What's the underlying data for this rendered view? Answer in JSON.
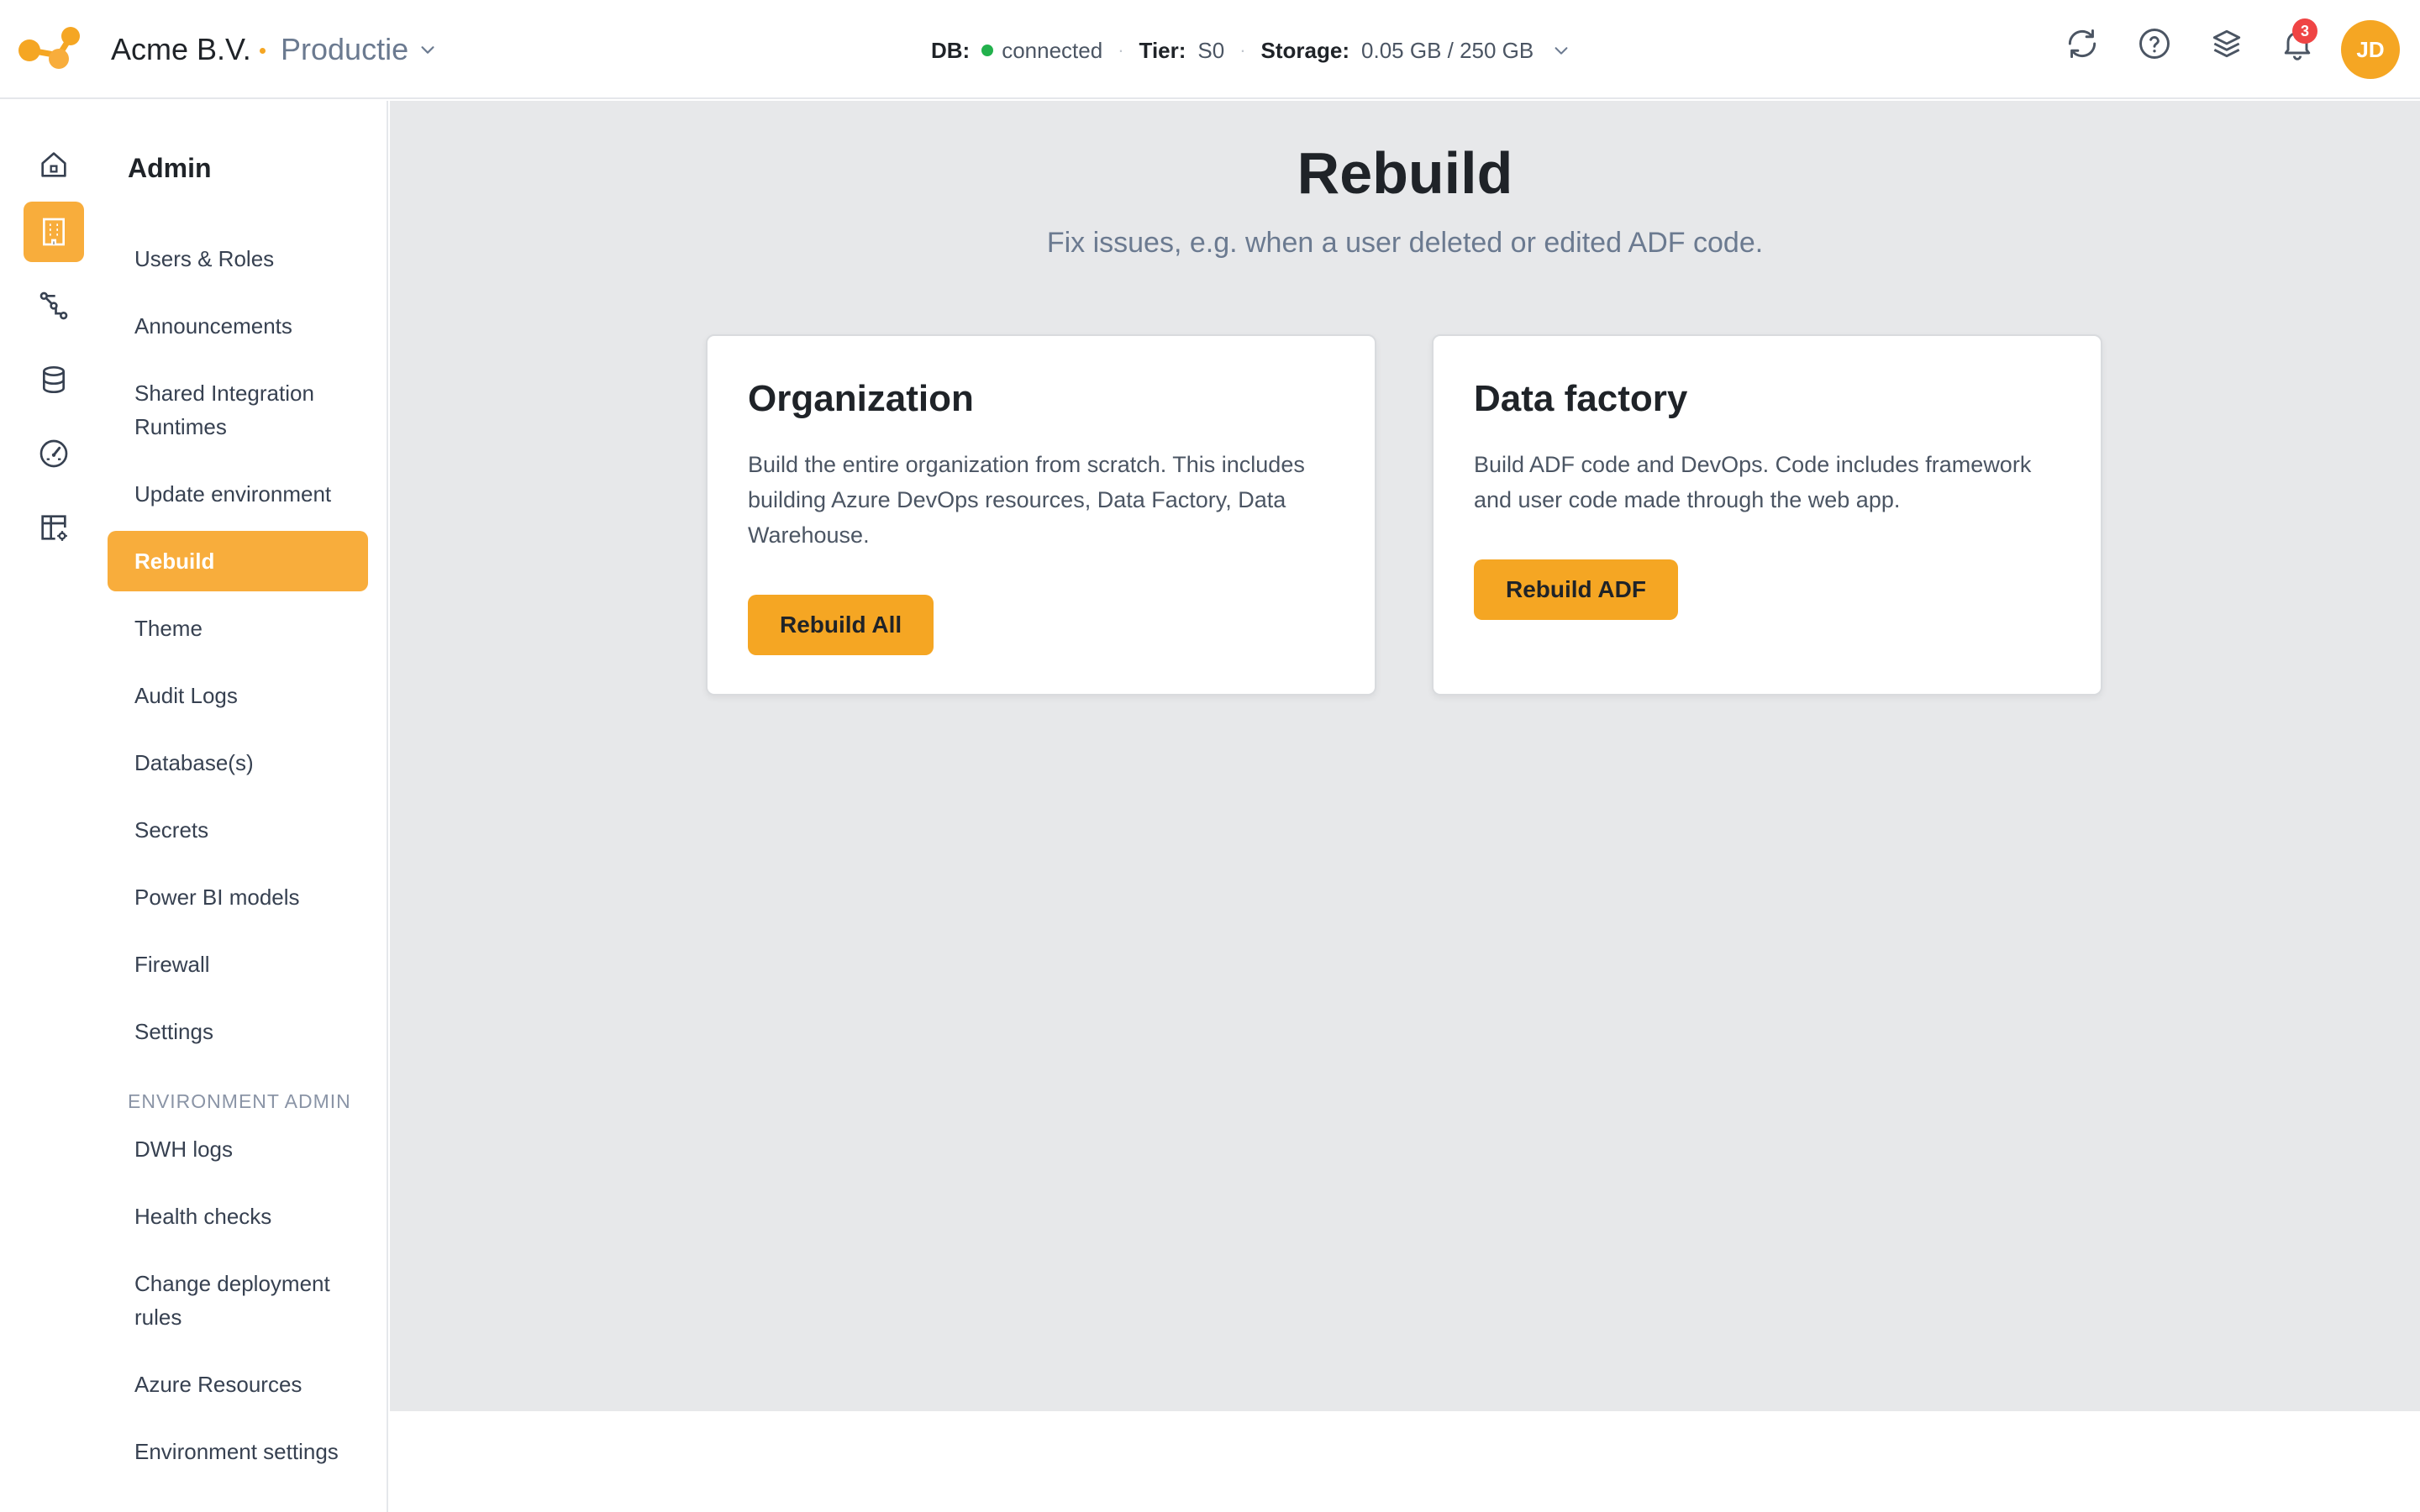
{
  "header": {
    "org_name": "Acme B.V.",
    "environment": "Productie",
    "db_label": "DB:",
    "db_status": "connected",
    "tier_label": "Tier:",
    "tier_value": "S0",
    "storage_label": "Storage:",
    "storage_value": "0.05 GB / 250 GB",
    "notification_count": "3",
    "avatar_initials": "JD",
    "accent_color": "#f5a623",
    "status_color": "#22b14c"
  },
  "rail": {
    "items": [
      "home-icon",
      "building-icon",
      "pipeline-icon",
      "database-icon",
      "gauge-icon",
      "table-settings-icon"
    ],
    "active": "building-icon"
  },
  "nav": {
    "title": "Admin",
    "items": [
      "Users & Roles",
      "Announcements",
      "Shared Integration",
      "Runtimes",
      "Update environment",
      "Rebuild",
      "Theme",
      "Audit Logs",
      "Database(s)",
      "Secrets",
      "Power BI models",
      "Firewall",
      "Settings"
    ],
    "section_label": "ENVIRONMENT ADMIN",
    "env_items": [
      "DWH logs",
      "Health checks",
      "Change deployment",
      "rules",
      "Azure Resources",
      "Environment settings"
    ]
  },
  "main": {
    "title": "Rebuild",
    "subtitle": "Fix issues, e.g. when a user deleted or edited ADF code.",
    "cards": [
      {
        "title": "Organization",
        "description": "Build the entire organization from scratch. This includes building Azure DevOps resources, Data Factory, Data Warehouse.",
        "button": "Rebuild All"
      },
      {
        "title": "Data factory",
        "description": "Build ADF code and DevOps. Code includes framework and user code made through the web app.",
        "button": "Rebuild ADF"
      }
    ]
  }
}
